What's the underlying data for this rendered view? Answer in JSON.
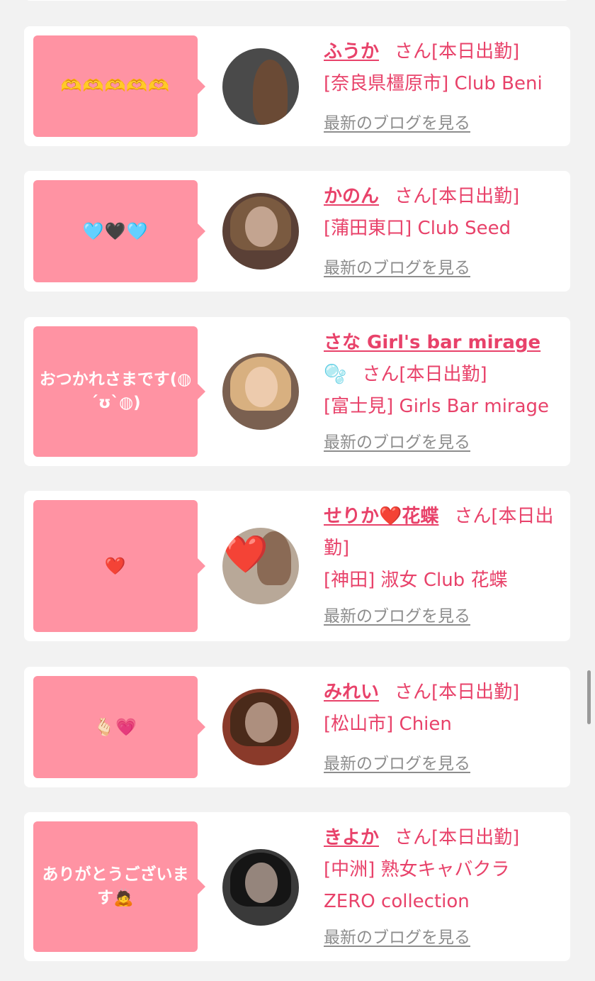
{
  "cards": [
    {
      "message": "🫶🫶🫶🫶🫶",
      "name": "ふうか",
      "san": "さん[本日出勤]",
      "icon": "",
      "shop": "[奈良県橿原市] Club Beni",
      "blog_link": "最新のブログを見る",
      "colors": {
        "avatar": "#4a4a4a",
        "hair": "#6a4a35"
      }
    },
    {
      "message": "🩵🖤🩵",
      "name": "かのん",
      "san": "さん[本日出勤]",
      "icon": "",
      "shop": "[蒲田東口] Club Seed",
      "blog_link": "最新のブログを見る",
      "colors": {
        "avatar": "#5a4036",
        "hair": "#7a5a40"
      }
    },
    {
      "message": "おつかれさまです(◍´ʊ`◍)",
      "name": "さな Girl's bar mirage",
      "san": "さん[本日出勤]",
      "icon": "🫧",
      "shop": "[富士見] Girls Bar mirage",
      "blog_link": "最新のブログを見る",
      "colors": {
        "avatar": "#7a6050",
        "hair": "#d8b080"
      }
    },
    {
      "message": "❤️",
      "name": "せりか❤️花蝶",
      "san": "さん[本日出勤]",
      "icon": "",
      "shop": "[神田] 淑女 Club 花蝶",
      "blog_link": "最新のブログを見る",
      "colors": {
        "avatar": "#b8a898",
        "hair": "#8a6a55"
      }
    },
    {
      "message": "🫰🏻💗",
      "name": "みれい",
      "san": "さん[本日出勤]",
      "icon": "",
      "shop": "[松山市] Chien",
      "blog_link": "最新のブログを見る",
      "colors": {
        "avatar": "#8a3a2a",
        "hair": "#4a2a1a"
      }
    },
    {
      "message": "ありがとうございます🙇",
      "name": "きよか",
      "san": "さん[本日出勤]",
      "icon": "",
      "shop": "[中洲] 熟女キャバクラ ZERO collection",
      "blog_link": "最新のブログを見る",
      "colors": {
        "avatar": "#3a3a3a",
        "hair": "#151515"
      }
    }
  ]
}
